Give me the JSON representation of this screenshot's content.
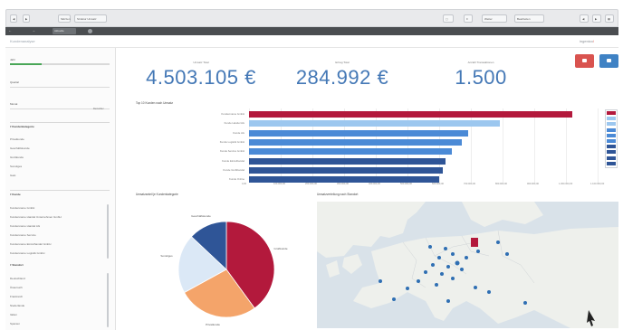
{
  "browser": {
    "nav_buttons": [
      "◀",
      "▶"
    ],
    "address": "Skizzen",
    "sheet": "Struktur Umsatz",
    "tabs": [
      "Weiter",
      "Bearbeiten"
    ],
    "right_icons": [
      "◀",
      "▶"
    ]
  },
  "toolbar2": {
    "chip": "Aktuelle Auswahl",
    "icons": [
      "←",
      "→"
    ]
  },
  "app": {
    "title": "Kundenanalyse",
    "logo_a": "ingenico",
    "logo_b": "/"
  },
  "sidebar": {
    "label_top": "Jahr",
    "field_1": "Quartal",
    "field_2": "Monat",
    "field_2_value": "Dezember",
    "group_1": "Kundenkategorie",
    "group_1_items": [
      "Privatkunde",
      "Geschäftskunde",
      "Großkunde",
      "Sonstiges",
      "Gast"
    ],
    "group_2": "Kunde",
    "group_2_items": [
      "Kundenname GmbH",
      "Kundenname Handel Unternehmen GmbH",
      "Kundenname Handel AG",
      "Kundenname Service",
      "Kundenname Einzelhandel GmbH",
      "Kundenname Logistik GmbH"
    ],
    "group_3": "Standort",
    "group_3_items": [
      "Deutschland",
      "Österreich",
      "Frankreich",
      "Niederlande",
      "Italien",
      "Spanien"
    ]
  },
  "kpis": [
    {
      "label": "Umsatz Total",
      "value": "4.503.105 €"
    },
    {
      "label": "Ertrag Total",
      "value": "284.992 €"
    },
    {
      "label": "Anzahl Transaktionen",
      "value": "1.500"
    }
  ],
  "colors": {
    "accent_blue": "#4478b6",
    "red": "#b3193c",
    "dark_blue": "#2f5597",
    "mid_blue": "#4b8ad6",
    "light_blue": "#9cc7ef",
    "peach": "#f4a46a",
    "pale_blue": "#dbe8f6"
  },
  "bar_chart": {
    "title": "Top 10 Kunden nach Umsatz",
    "legend_title": "",
    "categories": [
      "Kundenname GmbH",
      "Kunde Handel AG",
      "Kunde AG",
      "Kunde Logistik GmbH",
      "Kunde Service GmbH",
      "Kunde Einzelhandel",
      "Kunde Großhandel",
      "Kunde Online"
    ],
    "values": [
      1020000,
      790000,
      690000,
      670000,
      640000,
      620000,
      610000,
      600000
    ],
    "xmax": 1100000,
    "ticks": [
      "0,00",
      "100.000,00",
      "200.000,00",
      "300.000,00",
      "400.000,00",
      "500.000,00",
      "600.000,00",
      "700.000,00",
      "800.000,00",
      "900.000,00",
      "1.000.000,00",
      "1.100.000,00"
    ]
  },
  "chart_data": [
    {
      "type": "bar",
      "title": "Top 10 Kunden nach Umsatz",
      "categories": [
        "Kundenname GmbH",
        "Kunde Handel AG",
        "Kunde AG",
        "Kunde Logistik GmbH",
        "Kunde Service GmbH",
        "Kunde Einzelhandel",
        "Kunde Großhandel",
        "Kunde Online"
      ],
      "values": [
        1020000,
        790000,
        690000,
        670000,
        640000,
        620000,
        610000,
        600000
      ],
      "xlim": [
        0,
        1100000
      ],
      "orientation": "horizontal"
    },
    {
      "type": "pie",
      "title": "Umsatzanteil je Kundenkategorie",
      "categories": [
        "Großkunde",
        "Privatkunde",
        "Sonstiges",
        "Geschäftskunde"
      ],
      "values": [
        40,
        27,
        20,
        13
      ]
    }
  ],
  "pie": {
    "title": "Umsatzanteil je Kundenkategorie",
    "slices": [
      {
        "label": "Großkunde",
        "value": 40,
        "color": "#b3193c"
      },
      {
        "label": "Privatkunde",
        "value": 27,
        "color": "#f4a46a"
      },
      {
        "label": "Sonstiges",
        "value": 20,
        "color": "#dbe8f6"
      },
      {
        "label": "Geschäftskunde",
        "value": 13,
        "color": "#2f5597"
      }
    ]
  },
  "map": {
    "title": "Umsatzverteilung nach Standort"
  }
}
